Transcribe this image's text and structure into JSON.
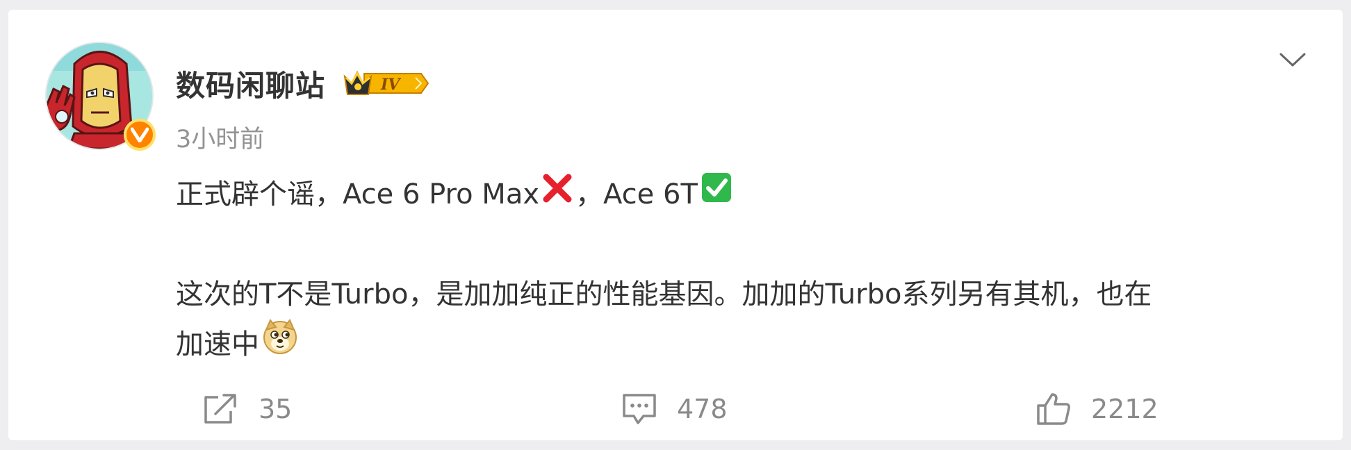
{
  "post": {
    "username": "数码闲聊站",
    "vip_level": "IV",
    "timestamp": "3小时前",
    "line1_part1": "正式辟个谣，Ace 6 Pro Max",
    "line1_part2": "，Ace 6T",
    "line2": "这次的T不是Turbo，是加加纯正的性能基因。加加的Turbo系列另有其机，也在",
    "line3": "加速中"
  },
  "actions": {
    "repost_count": "35",
    "comment_count": "478",
    "like_count": "2212"
  },
  "icons": {
    "avatar": "iron-man-avatar",
    "verify": "verified-v-badge",
    "vip": "crown-vip-badge",
    "dropdown": "chevron-down-icon",
    "wrong": "red-x-emoji",
    "right": "green-check-emoji",
    "doge": "doge-emoji",
    "repost": "share-icon",
    "comment": "comment-icon",
    "like": "thumbs-up-icon"
  },
  "colors": {
    "verify_badge": "#ff8200",
    "vip_gold": "#f7b500",
    "text_primary": "#333333",
    "text_secondary": "#939393",
    "cross_red": "#e5212e",
    "check_green": "#2fb84b"
  }
}
